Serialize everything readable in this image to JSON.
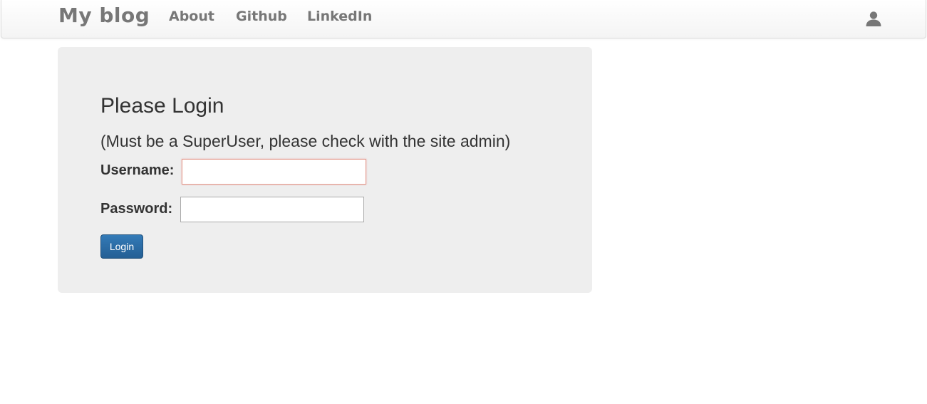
{
  "navbar": {
    "brand": "My blog",
    "links": [
      {
        "label": "About"
      },
      {
        "label": "Github"
      },
      {
        "label": "LinkedIn"
      }
    ],
    "user_icon": "user-icon"
  },
  "login": {
    "title": "Please Login",
    "subtitle": "(Must be a SuperUser, please check with the site admin)",
    "username_label": "Username:",
    "username_value": "",
    "password_label": "Password:",
    "password_value": "",
    "submit_label": "Login"
  },
  "colors": {
    "panel_background": "#eeeeee",
    "button_primary": "#337ab7",
    "nav_text": "#777777",
    "focus_border": "#e39a8c"
  }
}
